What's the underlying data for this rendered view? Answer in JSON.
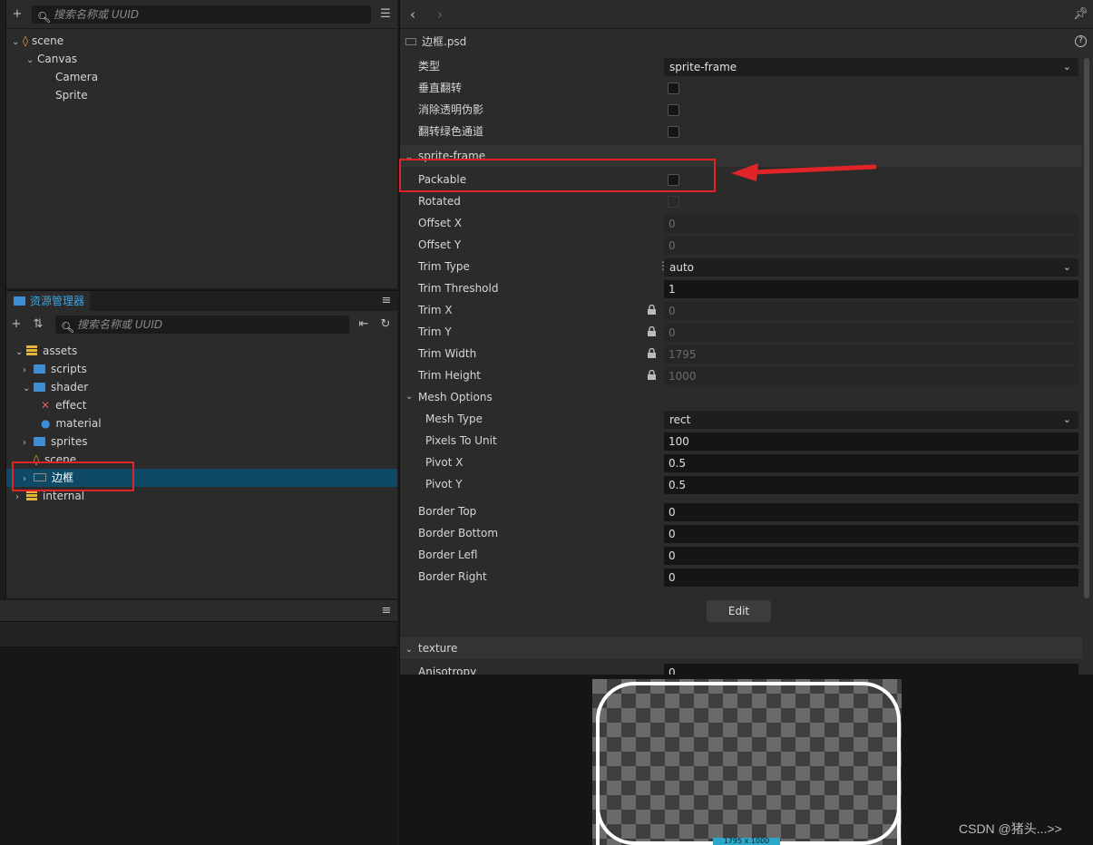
{
  "hierarchy": {
    "search_placeholder": "搜索名称或 UUID",
    "nodes": [
      {
        "label": "scene"
      },
      {
        "label": "Canvas"
      },
      {
        "label": "Camera"
      },
      {
        "label": "Sprite"
      }
    ]
  },
  "assets_panel": {
    "tab_label": "资源管理器",
    "search_placeholder": "搜索名称或 UUID",
    "items": [
      {
        "label": "assets"
      },
      {
        "label": "scripts"
      },
      {
        "label": "shader"
      },
      {
        "label": "effect"
      },
      {
        "label": "material"
      },
      {
        "label": "sprites"
      },
      {
        "label": "scene"
      },
      {
        "label": "边框"
      },
      {
        "label": "internal"
      }
    ]
  },
  "inspector": {
    "file_name": "边框.psd",
    "props_top": [
      {
        "label": "类型",
        "value": "sprite-frame"
      },
      {
        "label": "垂直翻转"
      },
      {
        "label": "消除透明伪影"
      },
      {
        "label": "翻转绿色通道"
      }
    ],
    "section_sprite_frame": "sprite-frame",
    "sprite_props": {
      "packable": "Packable",
      "rotated": "Rotated",
      "offset_x": {
        "label": "Offset X",
        "value": "0"
      },
      "offset_y": {
        "label": "Offset Y",
        "value": "0"
      },
      "trim_type": {
        "label": "Trim Type",
        "value": "auto"
      },
      "trim_threshold": {
        "label": "Trim Threshold",
        "value": "1"
      },
      "trim_x": {
        "label": "Trim X",
        "value": "0"
      },
      "trim_y": {
        "label": "Trim Y",
        "value": "0"
      },
      "trim_width": {
        "label": "Trim Width",
        "value": "1795"
      },
      "trim_height": {
        "label": "Trim Height",
        "value": "1000"
      }
    },
    "section_mesh": "Mesh Options",
    "mesh_props": {
      "mesh_type": {
        "label": "Mesh Type",
        "value": "rect"
      },
      "pixels_to_unit": {
        "label": "Pixels To Unit",
        "value": "100"
      },
      "pivot_x": {
        "label": "Pivot X",
        "value": "0.5"
      },
      "pivot_y": {
        "label": "Pivot Y",
        "value": "0.5"
      }
    },
    "border_props": {
      "top": {
        "label": "Border Top",
        "value": "0"
      },
      "bottom": {
        "label": "Border Bottom",
        "value": "0"
      },
      "left": {
        "label": "Border Lefl",
        "value": "0"
      },
      "right": {
        "label": "Border Right",
        "value": "0"
      }
    },
    "edit_button": "Edit",
    "section_texture": "texture",
    "anisotropy": {
      "label": "Anisotropy",
      "value": "0"
    }
  },
  "preview": {
    "dimension_label": "1795 x 1000"
  },
  "watermark": "CSDN @猪头...>>",
  "colors": {
    "accent": "#3aa6e6",
    "highlight_box": "#e0242a",
    "selection": "#0e4a66"
  }
}
